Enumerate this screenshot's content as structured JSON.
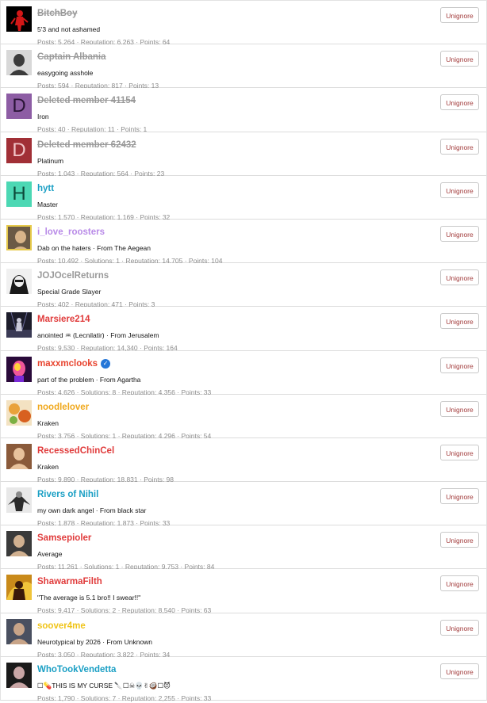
{
  "button_label": "Unignore",
  "users": [
    {
      "name": "BitchBoy",
      "name_color": "#9a9a9a",
      "struck": true,
      "title": "5'3 and not ashamed",
      "stats": "Posts: 5,264 · Reputation: 6,263 · Points: 64",
      "avatar": {
        "type": "photo",
        "icon": "dark-figure-avatar",
        "bg": "#000000",
        "fg": "#d21717"
      }
    },
    {
      "name": "Captain Albania",
      "name_color": "#9a9a9a",
      "struck": true,
      "title": "easygoing asshole",
      "stats": "Posts: 594 · Reputation: 817 · Points: 13",
      "avatar": {
        "type": "photo",
        "icon": "portrait-avatar",
        "bg": "#d8d8d8",
        "fg": "#3b3b3b"
      }
    },
    {
      "name": "Deleted member 41154",
      "name_color": "#9a9a9a",
      "struck": true,
      "title": "Iron",
      "stats": "Posts: 40 · Reputation: 11 · Points: 1",
      "avatar": {
        "type": "letter",
        "letter": "D",
        "bg": "#8d5da4",
        "fg": "#2a1436"
      }
    },
    {
      "name": "Deleted member 62432",
      "name_color": "#9a9a9a",
      "struck": true,
      "title": "Platinum",
      "stats": "Posts: 1,043 · Reputation: 564 · Points: 23",
      "avatar": {
        "type": "letter",
        "letter": "D",
        "bg": "#a12f36",
        "fg": "#f1c5c8"
      }
    },
    {
      "name": "hytt",
      "name_color": "#1a9fc4",
      "struck": false,
      "title": "Master",
      "stats": "Posts: 1,570 · Reputation: 1,169 · Points: 32",
      "avatar": {
        "type": "letter",
        "letter": "H",
        "bg": "#4cd8b4",
        "fg": "#0d4a3a"
      }
    },
    {
      "name": "i_love_roosters",
      "name_color": "#b98be8",
      "struck": false,
      "title": "Dab on the haters · From The Aegean",
      "stats": "Posts: 10,492 · Solutions: 1 · Reputation: 14,705 · Points: 104",
      "avatar": {
        "type": "photo",
        "icon": "portrait-avatar",
        "bg": "#6b5a45",
        "fg": "#d9b58a",
        "bordered": true
      }
    },
    {
      "name": "JOJOcelReturns",
      "name_color": "#9a9a9a",
      "struck": false,
      "title": "Special Grade Slayer",
      "stats": "Posts: 402 · Reputation: 471 · Points: 3",
      "avatar": {
        "type": "photo",
        "icon": "manga-avatar",
        "bg": "#f0f0f0",
        "fg": "#1a1a1a"
      }
    },
    {
      "name": "Marsiere214",
      "name_color": "#e03b3b",
      "struck": false,
      "title": "anointed ♒ (Lecnilatir) · From Jerusalem",
      "stats": "Posts: 9,530 · Reputation: 14,340 · Points: 164",
      "avatar": {
        "type": "photo",
        "icon": "stage-avatar",
        "bg": "#1c1c2a",
        "fg": "#c9c9d8"
      }
    },
    {
      "name": "maxxmclooks",
      "name_color": "#e8442f",
      "struck": false,
      "verified": true,
      "title": "part of the problem · From Agartha",
      "stats": "Posts: 4,626 · Solutions: 8 · Reputation: 4,356 · Points: 33",
      "avatar": {
        "type": "photo",
        "icon": "neon-head-avatar",
        "bg": "#2a0a3a",
        "fg": "#f0569a"
      }
    },
    {
      "name": "noodlelover",
      "name_color": "#f0a81c",
      "struck": false,
      "title": "Kraken",
      "stats": "Posts: 3,756 · Solutions: 1 · Reputation: 4,296 · Points: 54",
      "avatar": {
        "type": "photo",
        "icon": "food-avatar",
        "bg": "#f3e2c2",
        "fg": "#d8601f"
      }
    },
    {
      "name": "RecessedChinCel",
      "name_color": "#e03b3b",
      "struck": false,
      "title": "Kraken",
      "stats": "Posts: 9,890 · Reputation: 18,831 · Points: 98",
      "avatar": {
        "type": "photo",
        "icon": "portrait-avatar",
        "bg": "#8a5a3a",
        "fg": "#e8c29c"
      }
    },
    {
      "name": "Rivers of Nihil",
      "name_color": "#1a9fc4",
      "struck": false,
      "title": "my own dark angel · From black star",
      "stats": "Posts: 1,878 · Reputation: 1,873 · Points: 33",
      "avatar": {
        "type": "photo",
        "icon": "winged-figure-avatar",
        "bg": "#e8e8e8",
        "fg": "#2b2b2b"
      }
    },
    {
      "name": "Samsepioler",
      "name_color": "#e03b3b",
      "struck": false,
      "title": "Average",
      "stats": "Posts: 11,261 · Solutions: 1 · Reputation: 9,753 · Points: 84",
      "avatar": {
        "type": "photo",
        "icon": "portrait-avatar",
        "bg": "#3a3a3a",
        "fg": "#d0b090"
      }
    },
    {
      "name": "ShawarmaFilth",
      "name_color": "#e03b3b",
      "struck": false,
      "title": "\"The average is 5.1 bro!! I swear!!\"",
      "stats": "Posts: 9,417 · Solutions: 2 · Reputation: 8,540 · Points: 63",
      "avatar": {
        "type": "photo",
        "icon": "fire-figure-avatar",
        "bg": "#c98a1a",
        "fg": "#3a1a0a"
      }
    },
    {
      "name": "soover4me",
      "name_color": "#f0c419",
      "struck": false,
      "title": "Neurotypical by 2026 · From Unknown",
      "stats": "Posts: 3,050 · Reputation: 3,822 · Points: 34",
      "avatar": {
        "type": "photo",
        "icon": "portrait-avatar",
        "bg": "#4a5060",
        "fg": "#c8a488"
      }
    },
    {
      "name": "WhoTookVendetta",
      "name_color": "#1a9fc4",
      "struck": false,
      "title": "☐💊THIS IS MY CURSE 🔪☐☠💀✌🥥☐😈",
      "stats": "Posts: 1,790 · Solutions: 7 · Reputation: 2,255 · Points: 33",
      "avatar": {
        "type": "photo",
        "icon": "portrait-avatar",
        "bg": "#1a1a1a",
        "fg": "#c9a6a6"
      }
    }
  ]
}
